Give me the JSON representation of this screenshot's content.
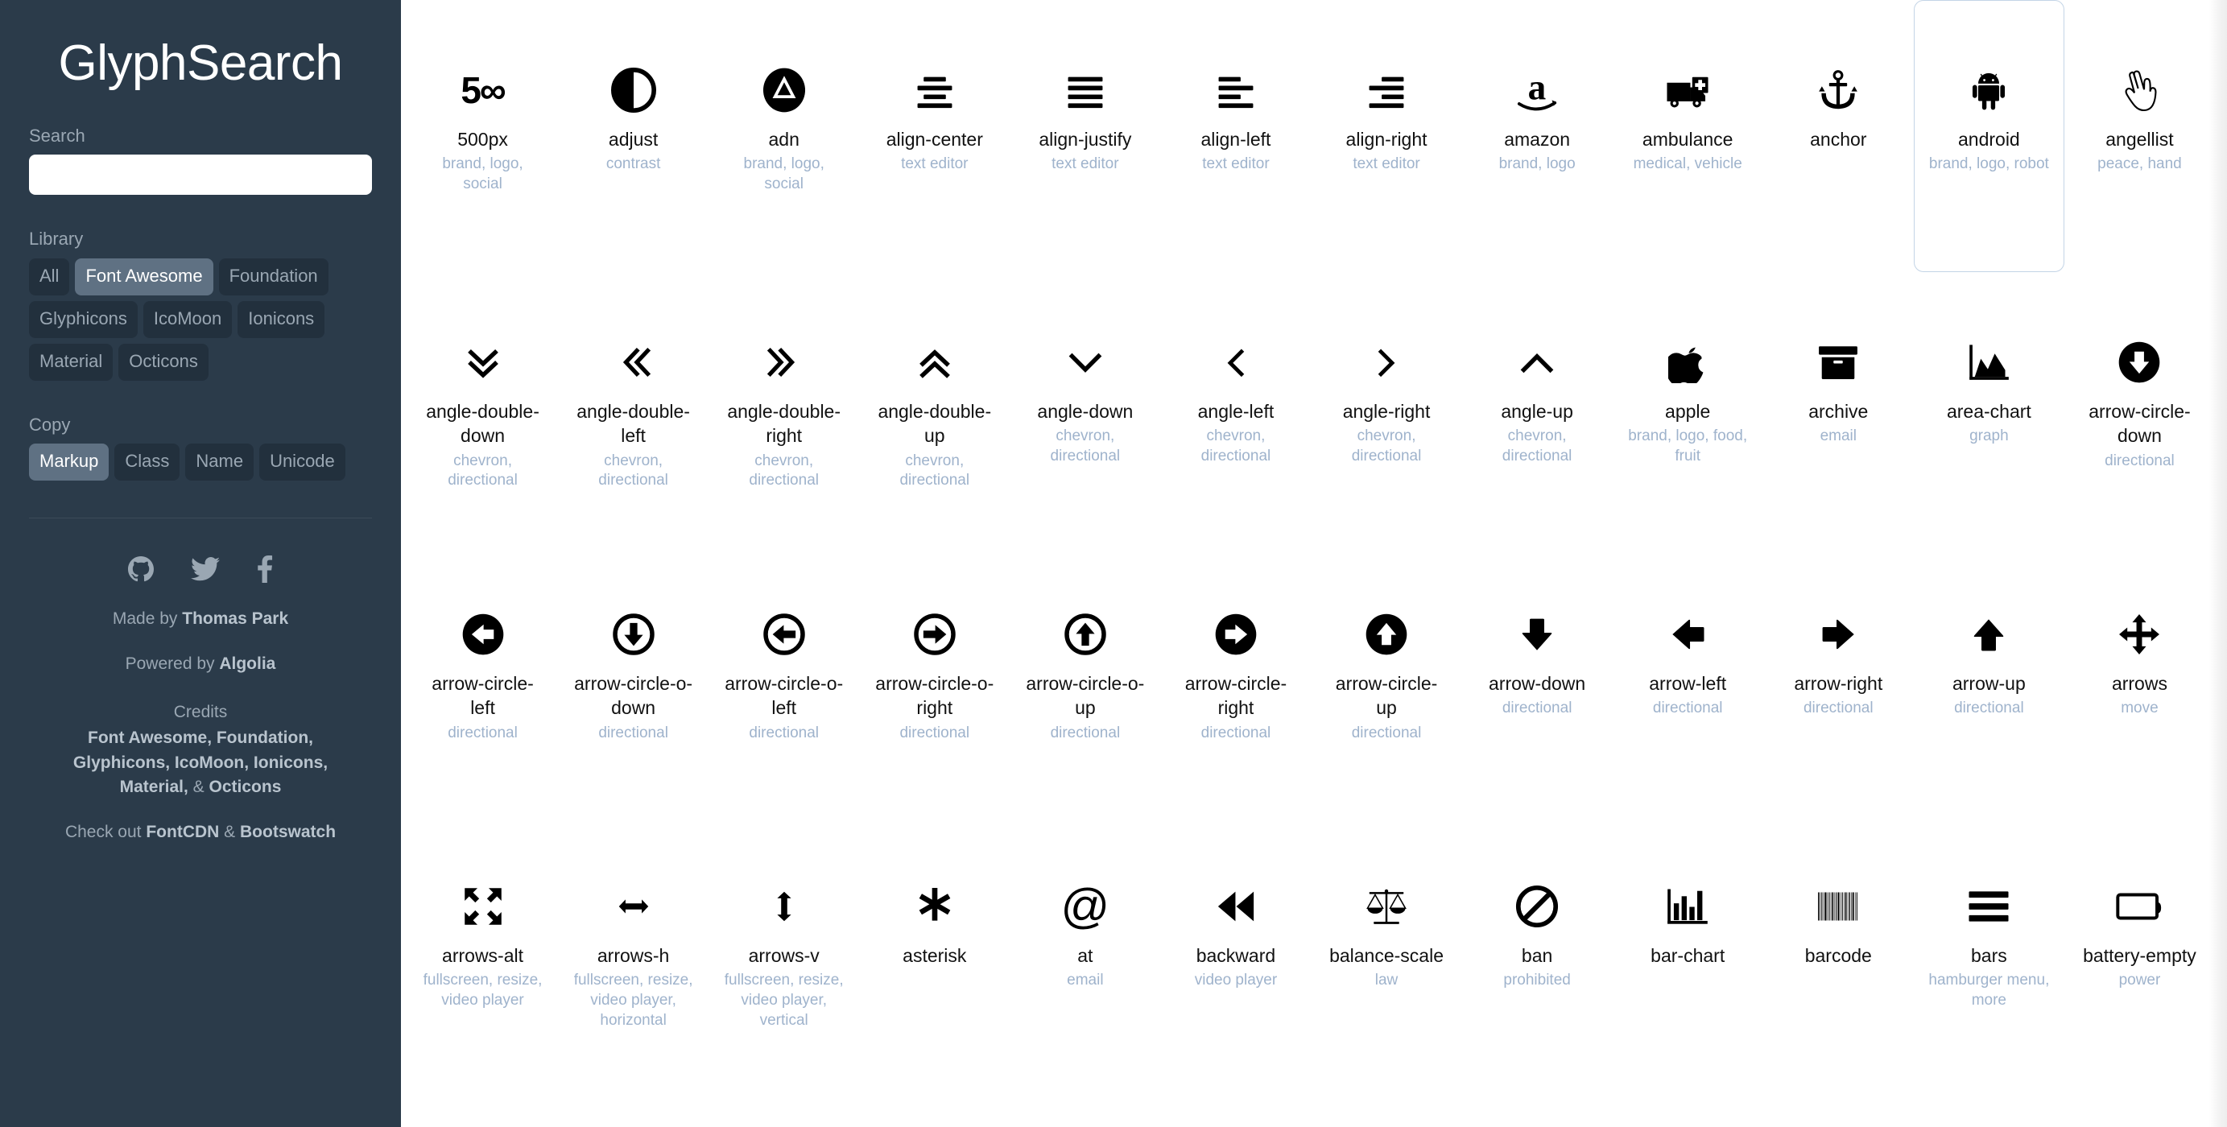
{
  "sidebar": {
    "brand": "GlyphSearch",
    "search": {
      "label": "Search",
      "value": "",
      "placeholder": ""
    },
    "library": {
      "label": "Library",
      "options": [
        "All",
        "Font Awesome",
        "Foundation",
        "Glyphicons",
        "IcoMoon",
        "Ionicons",
        "Material",
        "Octicons"
      ],
      "selected": "Font Awesome"
    },
    "copy": {
      "label": "Copy",
      "options": [
        "Markup",
        "Class",
        "Name",
        "Unicode"
      ],
      "selected": "Markup"
    },
    "social": [
      "github-icon",
      "twitter-icon",
      "facebook-icon"
    ],
    "footer": {
      "made_by_prefix": "Made by ",
      "made_by_name": "Thomas Park",
      "powered_by_prefix": "Powered by ",
      "powered_by_name": "Algolia",
      "credits_label": "Credits",
      "credits_line1": "Font Awesome, Foundation,",
      "credits_line2": "Glyphicons, IcoMoon, Ionicons,",
      "credits_line3a": "Material,",
      "credits_line3b": " & ",
      "credits_line3c": "Octicons",
      "checkout_prefix": "Check out ",
      "checkout_a": "FontCDN",
      "checkout_amp": " & ",
      "checkout_b": "Bootswatch"
    }
  },
  "colors": {
    "sidebar_bg": "#2b3b4a",
    "pill_bg": "#22303d",
    "pill_active_bg": "#5f7183",
    "tag_text": "#9fb3cc",
    "hover_border": "#c3d4e6"
  },
  "grid": {
    "hovered": "android",
    "icons": [
      {
        "name": "500px",
        "tags": "brand, logo, social",
        "glyph": "500px-icon"
      },
      {
        "name": "adjust",
        "tags": "contrast",
        "glyph": "adjust-icon"
      },
      {
        "name": "adn",
        "tags": "brand, logo, social",
        "glyph": "adn-icon"
      },
      {
        "name": "align-center",
        "tags": "text editor",
        "glyph": "align-center-icon"
      },
      {
        "name": "align-justify",
        "tags": "text editor",
        "glyph": "align-justify-icon"
      },
      {
        "name": "align-left",
        "tags": "text editor",
        "glyph": "align-left-icon"
      },
      {
        "name": "align-right",
        "tags": "text editor",
        "glyph": "align-right-icon"
      },
      {
        "name": "amazon",
        "tags": "brand, logo",
        "glyph": "amazon-icon"
      },
      {
        "name": "ambulance",
        "tags": "medical, vehicle",
        "glyph": "ambulance-icon"
      },
      {
        "name": "anchor",
        "tags": "",
        "glyph": "anchor-icon"
      },
      {
        "name": "android",
        "tags": "brand, logo, robot",
        "glyph": "android-icon"
      },
      {
        "name": "angellist",
        "tags": "peace, hand",
        "glyph": "angellist-icon"
      },
      {
        "name": "angle-double-down",
        "tags": "chevron, directional",
        "glyph": "angle-double-down-icon"
      },
      {
        "name": "angle-double-left",
        "tags": "chevron, directional",
        "glyph": "angle-double-left-icon"
      },
      {
        "name": "angle-double-right",
        "tags": "chevron, directional",
        "glyph": "angle-double-right-icon"
      },
      {
        "name": "angle-double-up",
        "tags": "chevron, directional",
        "glyph": "angle-double-up-icon"
      },
      {
        "name": "angle-down",
        "tags": "chevron, directional",
        "glyph": "angle-down-icon"
      },
      {
        "name": "angle-left",
        "tags": "chevron, directional",
        "glyph": "angle-left-icon"
      },
      {
        "name": "angle-right",
        "tags": "chevron, directional",
        "glyph": "angle-right-icon"
      },
      {
        "name": "angle-up",
        "tags": "chevron, directional",
        "glyph": "angle-up-icon"
      },
      {
        "name": "apple",
        "tags": "brand, logo, food, fruit",
        "glyph": "apple-icon"
      },
      {
        "name": "archive",
        "tags": "email",
        "glyph": "archive-icon"
      },
      {
        "name": "area-chart",
        "tags": "graph",
        "glyph": "area-chart-icon"
      },
      {
        "name": "arrow-circle-down",
        "tags": "directional",
        "glyph": "arrow-circle-down-icon"
      },
      {
        "name": "arrow-circle-left",
        "tags": "directional",
        "glyph": "arrow-circle-left-icon"
      },
      {
        "name": "arrow-circle-o-down",
        "tags": "directional",
        "glyph": "arrow-circle-o-down-icon"
      },
      {
        "name": "arrow-circle-o-left",
        "tags": "directional",
        "glyph": "arrow-circle-o-left-icon"
      },
      {
        "name": "arrow-circle-o-right",
        "tags": "directional",
        "glyph": "arrow-circle-o-right-icon"
      },
      {
        "name": "arrow-circle-o-up",
        "tags": "directional",
        "glyph": "arrow-circle-o-up-icon"
      },
      {
        "name": "arrow-circle-right",
        "tags": "directional",
        "glyph": "arrow-circle-right-icon"
      },
      {
        "name": "arrow-circle-up",
        "tags": "directional",
        "glyph": "arrow-circle-up-icon"
      },
      {
        "name": "arrow-down",
        "tags": "directional",
        "glyph": "arrow-down-icon"
      },
      {
        "name": "arrow-left",
        "tags": "directional",
        "glyph": "arrow-left-icon"
      },
      {
        "name": "arrow-right",
        "tags": "directional",
        "glyph": "arrow-right-icon"
      },
      {
        "name": "arrow-up",
        "tags": "directional",
        "glyph": "arrow-up-icon"
      },
      {
        "name": "arrows",
        "tags": "move",
        "glyph": "arrows-icon"
      },
      {
        "name": "arrows-alt",
        "tags": "fullscreen, resize, video player",
        "glyph": "arrows-alt-icon"
      },
      {
        "name": "arrows-h",
        "tags": "fullscreen, resize, video player, horizontal",
        "glyph": "arrows-h-icon"
      },
      {
        "name": "arrows-v",
        "tags": "fullscreen, resize, video player, vertical",
        "glyph": "arrows-v-icon"
      },
      {
        "name": "asterisk",
        "tags": "",
        "glyph": "asterisk-icon"
      },
      {
        "name": "at",
        "tags": "email",
        "glyph": "at-icon"
      },
      {
        "name": "backward",
        "tags": "video player",
        "glyph": "backward-icon"
      },
      {
        "name": "balance-scale",
        "tags": "law",
        "glyph": "balance-scale-icon"
      },
      {
        "name": "ban",
        "tags": "prohibited",
        "glyph": "ban-icon"
      },
      {
        "name": "bar-chart",
        "tags": "",
        "glyph": "bar-chart-icon"
      },
      {
        "name": "barcode",
        "tags": "",
        "glyph": "barcode-icon"
      },
      {
        "name": "bars",
        "tags": "hamburger menu, more",
        "glyph": "bars-icon"
      },
      {
        "name": "battery-empty",
        "tags": "power",
        "glyph": "battery-empty-icon"
      }
    ]
  }
}
